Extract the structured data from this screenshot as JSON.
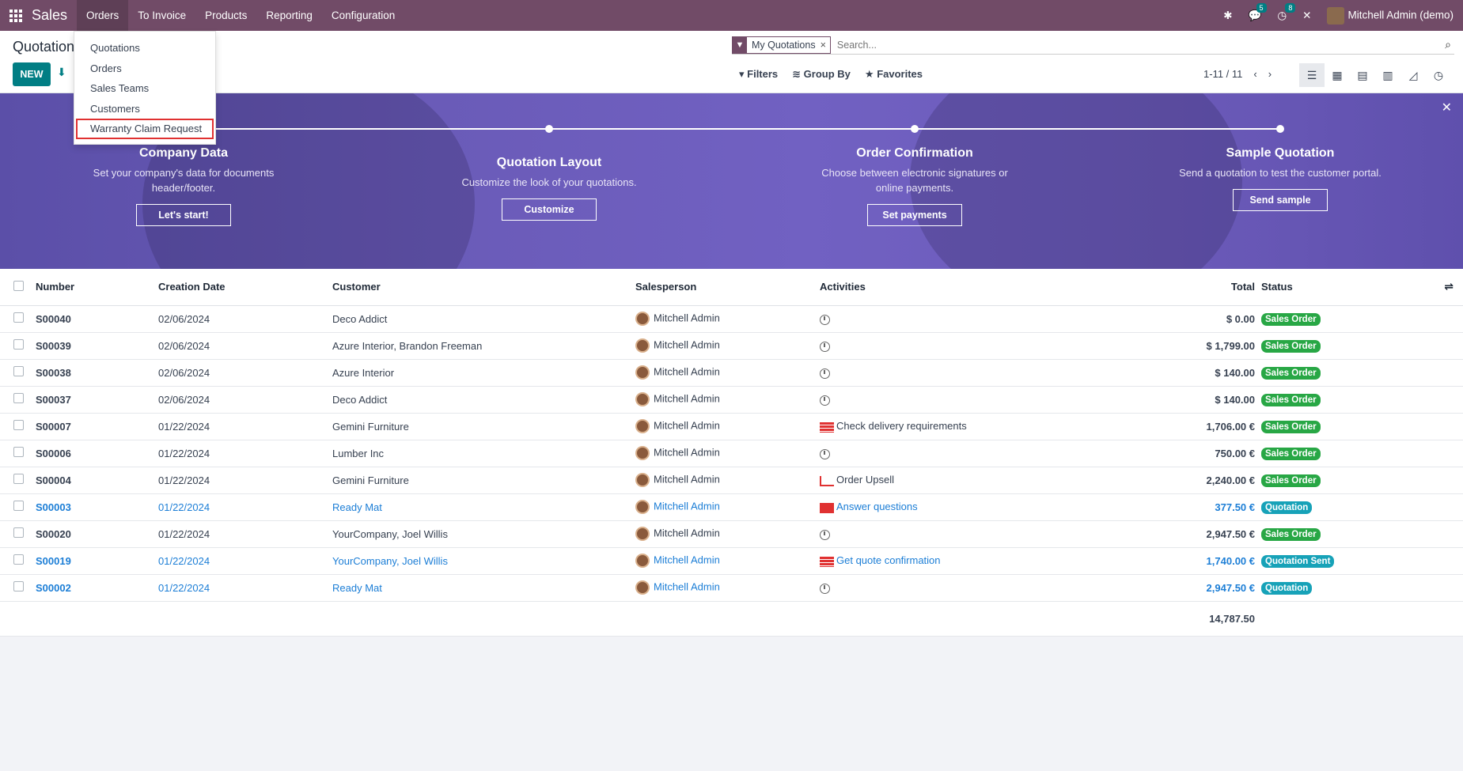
{
  "navbar": {
    "app_name": "Sales",
    "menu": [
      "Orders",
      "To Invoice",
      "Products",
      "Reporting",
      "Configuration"
    ],
    "messages_count": "5",
    "activities_count": "8",
    "user": "Mitchell Admin (demo)"
  },
  "dropdown": {
    "items": [
      "Quotations",
      "Orders",
      "Sales Teams",
      "Customers",
      "Warranty Claim Request"
    ]
  },
  "control": {
    "title": "Quotations",
    "new_label": "NEW",
    "facet": "My Quotations",
    "search_placeholder": "Search...",
    "filters_label": "Filters",
    "groupby_label": "Group By",
    "favorites_label": "Favorites",
    "pager": "1-11 / 11"
  },
  "banner": {
    "steps": [
      {
        "title": "Company Data",
        "desc": "Set your company's data for documents header/footer.",
        "button": "Let's start!"
      },
      {
        "title": "Quotation Layout",
        "desc": "Customize the look of your quotations.",
        "button": "Customize"
      },
      {
        "title": "Order Confirmation",
        "desc": "Choose between electronic signatures or online payments.",
        "button": "Set payments"
      },
      {
        "title": "Sample Quotation",
        "desc": "Send a quotation to test the customer portal.",
        "button": "Send sample"
      }
    ]
  },
  "table": {
    "headers": {
      "number": "Number",
      "date": "Creation Date",
      "customer": "Customer",
      "salesperson": "Salesperson",
      "activities": "Activities",
      "total": "Total",
      "status": "Status"
    },
    "rows": [
      {
        "number": "S00040",
        "date": "02/06/2024",
        "customer": "Deco Addict",
        "salesperson": "Mitchell Admin",
        "activity": "",
        "activity_icon": "clock",
        "total": "$ 0.00",
        "status": "Sales Order",
        "status_kind": "so",
        "draft": false
      },
      {
        "number": "S00039",
        "date": "02/06/2024",
        "customer": "Azure Interior, Brandon Freeman",
        "salesperson": "Mitchell Admin",
        "activity": "",
        "activity_icon": "clock",
        "total": "$ 1,799.00",
        "status": "Sales Order",
        "status_kind": "so",
        "draft": false
      },
      {
        "number": "S00038",
        "date": "02/06/2024",
        "customer": "Azure Interior",
        "salesperson": "Mitchell Admin",
        "activity": "",
        "activity_icon": "clock",
        "total": "$ 140.00",
        "status": "Sales Order",
        "status_kind": "so",
        "draft": false
      },
      {
        "number": "S00037",
        "date": "02/06/2024",
        "customer": "Deco Addict",
        "salesperson": "Mitchell Admin",
        "activity": "",
        "activity_icon": "clock",
        "total": "$ 140.00",
        "status": "Sales Order",
        "status_kind": "so",
        "draft": false
      },
      {
        "number": "S00007",
        "date": "01/22/2024",
        "customer": "Gemini Furniture",
        "salesperson": "Mitchell Admin",
        "activity": "Check delivery requirements",
        "activity_icon": "list",
        "total": "1,706.00 €",
        "status": "Sales Order",
        "status_kind": "so",
        "draft": false
      },
      {
        "number": "S00006",
        "date": "01/22/2024",
        "customer": "Lumber Inc",
        "salesperson": "Mitchell Admin",
        "activity": "",
        "activity_icon": "clock",
        "total": "750.00 €",
        "status": "Sales Order",
        "status_kind": "so",
        "draft": false
      },
      {
        "number": "S00004",
        "date": "01/22/2024",
        "customer": "Gemini Furniture",
        "salesperson": "Mitchell Admin",
        "activity": "Order Upsell",
        "activity_icon": "trend",
        "total": "2,240.00 €",
        "status": "Sales Order",
        "status_kind": "so",
        "draft": false
      },
      {
        "number": "S00003",
        "date": "01/22/2024",
        "customer": "Ready Mat",
        "salesperson": "Mitchell Admin",
        "activity": "Answer questions",
        "activity_icon": "envelope",
        "total": "377.50 €",
        "status": "Quotation",
        "status_kind": "q",
        "draft": true
      },
      {
        "number": "S00020",
        "date": "01/22/2024",
        "customer": "YourCompany, Joel Willis",
        "salesperson": "Mitchell Admin",
        "activity": "",
        "activity_icon": "clock",
        "total": "2,947.50 €",
        "status": "Sales Order",
        "status_kind": "so",
        "draft": false
      },
      {
        "number": "S00019",
        "date": "01/22/2024",
        "customer": "YourCompany, Joel Willis",
        "salesperson": "Mitchell Admin",
        "activity": "Get quote confirmation",
        "activity_icon": "list",
        "total": "1,740.00 €",
        "status": "Quotation Sent",
        "status_kind": "q",
        "draft": true
      },
      {
        "number": "S00002",
        "date": "01/22/2024",
        "customer": "Ready Mat",
        "salesperson": "Mitchell Admin",
        "activity": "",
        "activity_icon": "clock",
        "total": "2,947.50 €",
        "status": "Quotation",
        "status_kind": "q",
        "draft": true
      }
    ],
    "sum_total": "14,787.50"
  }
}
